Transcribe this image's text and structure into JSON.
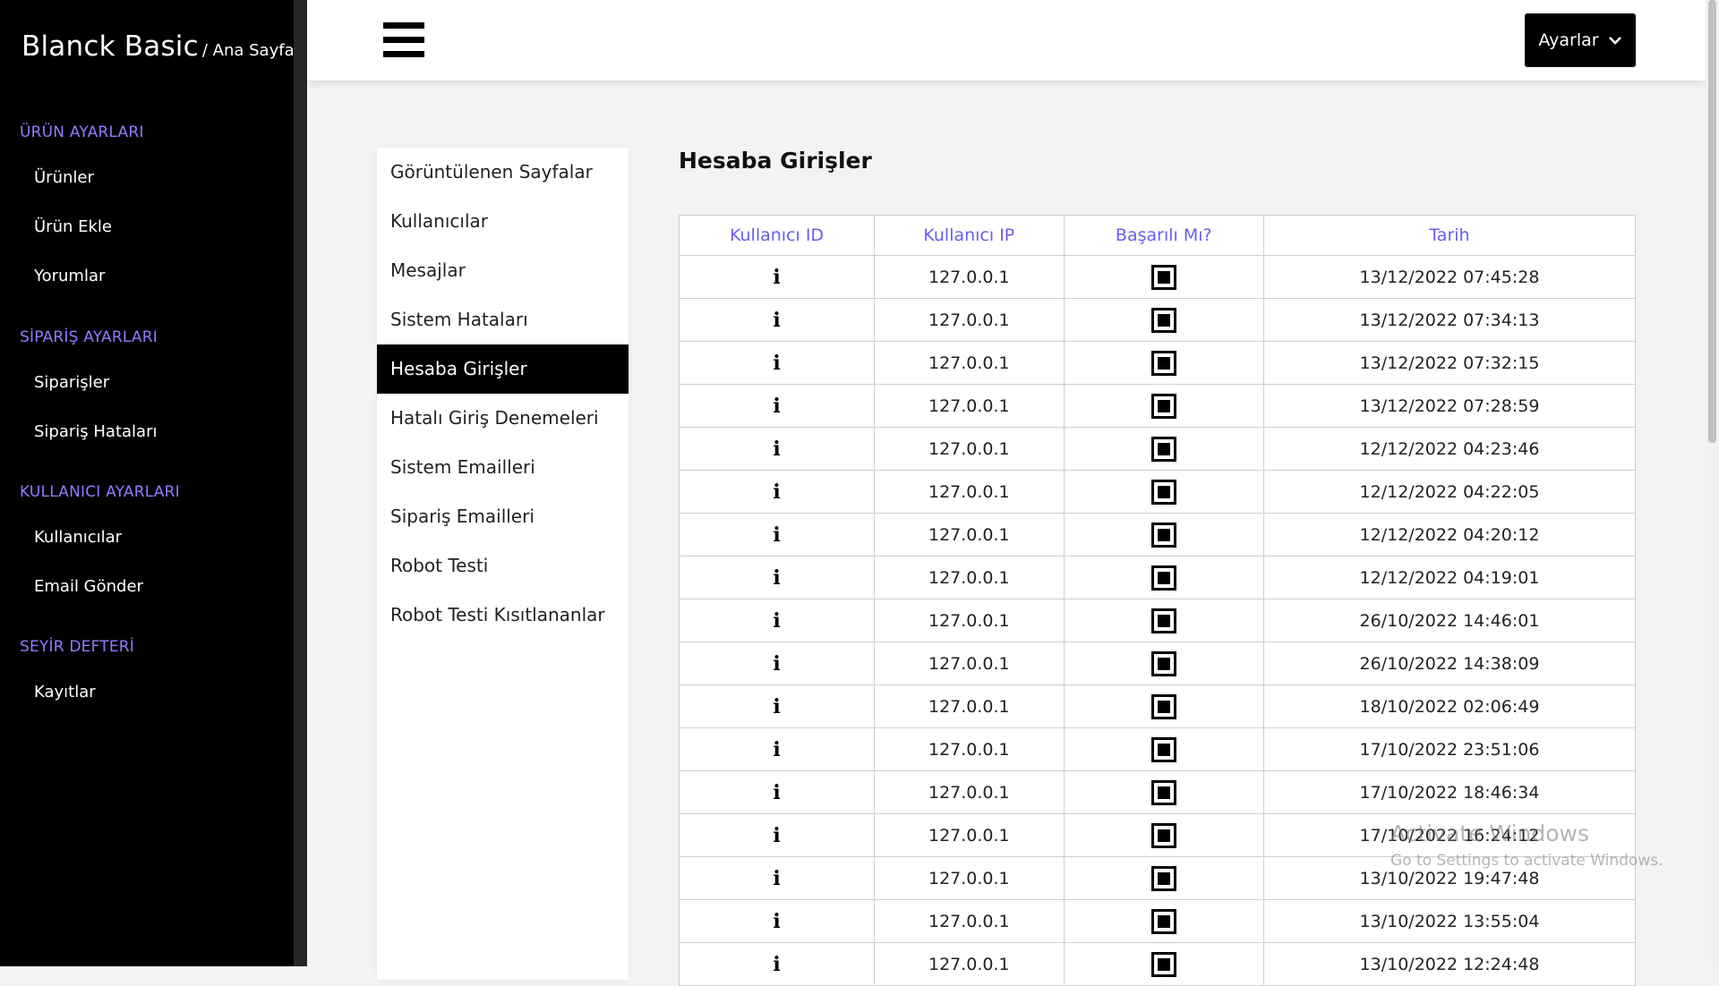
{
  "brand": {
    "title": "Blanck Basic",
    "breadcrumb": "/ Ana Sayfa"
  },
  "sidebar": {
    "sections": [
      {
        "title": "ÜRÜN AYARLARI",
        "items": [
          "Ürünler",
          "Ürün Ekle",
          "Yorumlar"
        ]
      },
      {
        "title": "SİPARİŞ AYARLARI",
        "items": [
          "Siparişler",
          "Sipariş Hataları"
        ]
      },
      {
        "title": "KULLANICI AYARLARI",
        "items": [
          "Kullanıcılar",
          "Email Gönder"
        ]
      },
      {
        "title": "SEYİR DEFTERİ",
        "items": [
          "Kayıtlar"
        ]
      }
    ]
  },
  "header": {
    "settings_label": "Ayarlar",
    "menu_icon": "hamburger-icon",
    "dropdown_icon": "chevron-down-icon"
  },
  "submenu": {
    "items": [
      "Görüntülenen Sayfalar",
      "Kullanıcılar",
      "Mesajlar",
      "Sistem Hataları",
      "Hesaba Girişler",
      "Hatalı Giriş Denemeleri",
      "Sistem Emailleri",
      "Sipariş Emailleri",
      "Robot Testi",
      "Robot Testi Kısıtlananlar"
    ],
    "active_index": 4
  },
  "main": {
    "title": "Hesaba Girişler",
    "table": {
      "headers": [
        "Kullanıcı ID",
        "Kullanıcı IP",
        "Başarılı Mı?",
        "Tarih"
      ],
      "rows": [
        {
          "user": "i",
          "ip": "127.0.0.1",
          "success": true,
          "date": "13/12/2022 07:45:28"
        },
        {
          "user": "i",
          "ip": "127.0.0.1",
          "success": true,
          "date": "13/12/2022 07:34:13"
        },
        {
          "user": "i",
          "ip": "127.0.0.1",
          "success": true,
          "date": "13/12/2022 07:32:15"
        },
        {
          "user": "i",
          "ip": "127.0.0.1",
          "success": true,
          "date": "13/12/2022 07:28:59"
        },
        {
          "user": "i",
          "ip": "127.0.0.1",
          "success": true,
          "date": "12/12/2022 04:23:46"
        },
        {
          "user": "i",
          "ip": "127.0.0.1",
          "success": true,
          "date": "12/12/2022 04:22:05"
        },
        {
          "user": "i",
          "ip": "127.0.0.1",
          "success": true,
          "date": "12/12/2022 04:20:12"
        },
        {
          "user": "i",
          "ip": "127.0.0.1",
          "success": true,
          "date": "12/12/2022 04:19:01"
        },
        {
          "user": "i",
          "ip": "127.0.0.1",
          "success": true,
          "date": "26/10/2022 14:46:01"
        },
        {
          "user": "i",
          "ip": "127.0.0.1",
          "success": true,
          "date": "26/10/2022 14:38:09"
        },
        {
          "user": "i",
          "ip": "127.0.0.1",
          "success": true,
          "date": "18/10/2022 02:06:49"
        },
        {
          "user": "i",
          "ip": "127.0.0.1",
          "success": true,
          "date": "17/10/2022 23:51:06"
        },
        {
          "user": "i",
          "ip": "127.0.0.1",
          "success": true,
          "date": "17/10/2022 18:46:34"
        },
        {
          "user": "i",
          "ip": "127.0.0.1",
          "success": true,
          "date": "17/10/2022 16:24:12"
        },
        {
          "user": "i",
          "ip": "127.0.0.1",
          "success": true,
          "date": "13/10/2022 19:47:48"
        },
        {
          "user": "i",
          "ip": "127.0.0.1",
          "success": true,
          "date": "13/10/2022 13:55:04"
        },
        {
          "user": "i",
          "ip": "127.0.0.1",
          "success": true,
          "date": "13/10/2022 12:24:48"
        }
      ]
    }
  },
  "watermark": {
    "title": "Activate Windows",
    "subtitle": "Go to Settings to activate Windows."
  },
  "colors": {
    "accent": "#6a5cf0",
    "section_title": "#8f7dff",
    "sidebar_bg": "#000000"
  }
}
